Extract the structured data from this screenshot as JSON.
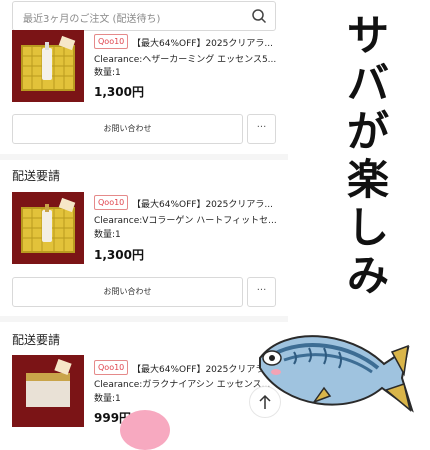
{
  "search": {
    "placeholder": "最近3ヶ月のご注文 (配送待ち)"
  },
  "orders": [
    {
      "section": "",
      "badge": "Qoo10",
      "title_line1": "【最大64%OFF】2025クリアラ...",
      "title_line2": "Clearance:ヘザーカーミング エッセンス5...",
      "qty": "数量:1",
      "price": "1,300円",
      "inquiry": "お問い合わせ",
      "more": "···"
    },
    {
      "section": "配送要請",
      "badge": "Qoo10",
      "title_line1": "【最大64%OFF】2025クリアラ...",
      "title_line2": "Clearance:Vコラーゲン ハートフィットセ...",
      "qty": "数量:1",
      "price": "1,300円",
      "inquiry": "お問い合わせ",
      "more": "···"
    },
    {
      "section": "配送要請",
      "badge": "Qoo10",
      "title_line1": "【最大64%OFF】2025クリアラ...",
      "title_line2": "Clearance:ガラクナイアシン エッセンス...",
      "qty": "数量:1",
      "price": "999円",
      "inquiry": "",
      "more": ""
    }
  ],
  "overlay": {
    "caption": [
      "サ",
      "バ",
      "が",
      "楽",
      "し",
      "み"
    ]
  },
  "icons": {
    "search": "search-icon",
    "scroll_top": "arrow-up-icon",
    "fish": "mackerel-illustration"
  },
  "colors": {
    "accent": "#e0454e",
    "thumb_bg": "#7b1416",
    "basket": "#e2c23a"
  }
}
